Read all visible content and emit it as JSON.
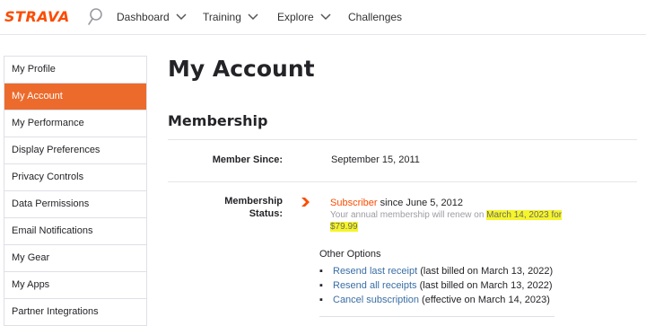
{
  "nav": {
    "logo": "STRAVA",
    "items": [
      {
        "label": "Dashboard"
      },
      {
        "label": "Training"
      },
      {
        "label": "Explore"
      },
      {
        "label": "Challenges"
      }
    ]
  },
  "sidebar": {
    "items": [
      {
        "label": "My Profile"
      },
      {
        "label": "My Account"
      },
      {
        "label": "My Performance"
      },
      {
        "label": "Display Preferences"
      },
      {
        "label": "Privacy Controls"
      },
      {
        "label": "Data Permissions"
      },
      {
        "label": "Email Notifications"
      },
      {
        "label": "My Gear"
      },
      {
        "label": "My Apps"
      },
      {
        "label": "Partner Integrations"
      }
    ]
  },
  "main": {
    "title": "My Account",
    "section_title": "Membership",
    "member_since": {
      "label": "Member Since:",
      "value": "September 15, 2011"
    },
    "membership_status": {
      "label_line1": "Membership",
      "label_line2": "Status:",
      "subscriber": "Subscriber",
      "since": " since June 5, 2012",
      "renew_prefix": "Your annual membership will renew on ",
      "renew_highlight": "March 14, 2023 for $79.99"
    },
    "other_options": {
      "title": "Other Options",
      "items": [
        {
          "link": "Resend last receipt",
          "note": " (last billed on March 13, 2022)"
        },
        {
          "link": "Resend all receipts",
          "note": " (last billed on March 13, 2022)"
        },
        {
          "link": "Cancel subscription",
          "note": " (effective on March 14, 2023)"
        }
      ]
    }
  },
  "colors": {
    "brand": "#fc4c02",
    "active_sidebar": "#ec6b2c",
    "link": "#3a6ea5",
    "highlight": "#f6f52a"
  }
}
